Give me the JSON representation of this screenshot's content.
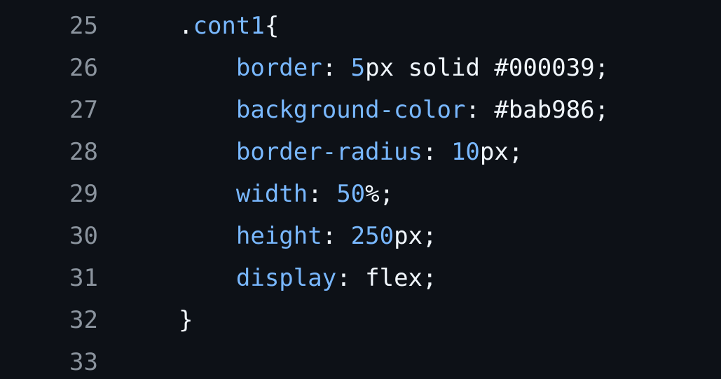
{
  "theme": {
    "background": "#0d1117",
    "line_number_color": "#8b949e",
    "keyword_color": "#79b8ff",
    "text_color": "#f0f6fc"
  },
  "lines": [
    {
      "number": "25",
      "tokens": [
        {
          "text": ".",
          "kind": "plain"
        },
        {
          "text": "cont1",
          "kind": "cls"
        },
        {
          "text": "{",
          "kind": "plain"
        }
      ]
    },
    {
      "number": "26",
      "tokens": [
        {
          "text": "    ",
          "kind": "plain"
        },
        {
          "text": "border",
          "kind": "prop"
        },
        {
          "text": ": ",
          "kind": "plain"
        },
        {
          "text": "5",
          "kind": "num"
        },
        {
          "text": "px solid #000039;",
          "kind": "plain"
        }
      ]
    },
    {
      "number": "27",
      "tokens": [
        {
          "text": "    ",
          "kind": "plain"
        },
        {
          "text": "background-color",
          "kind": "prop"
        },
        {
          "text": ": #bab986;",
          "kind": "plain"
        }
      ]
    },
    {
      "number": "28",
      "tokens": [
        {
          "text": "    ",
          "kind": "plain"
        },
        {
          "text": "border-radius",
          "kind": "prop"
        },
        {
          "text": ": ",
          "kind": "plain"
        },
        {
          "text": "10",
          "kind": "num"
        },
        {
          "text": "px;",
          "kind": "plain"
        }
      ]
    },
    {
      "number": "29",
      "tokens": [
        {
          "text": "    ",
          "kind": "plain"
        },
        {
          "text": "width",
          "kind": "prop"
        },
        {
          "text": ": ",
          "kind": "plain"
        },
        {
          "text": "50",
          "kind": "num"
        },
        {
          "text": "%;",
          "kind": "plain"
        }
      ]
    },
    {
      "number": "30",
      "tokens": [
        {
          "text": "    ",
          "kind": "plain"
        },
        {
          "text": "height",
          "kind": "prop"
        },
        {
          "text": ": ",
          "kind": "plain"
        },
        {
          "text": "250",
          "kind": "num"
        },
        {
          "text": "px;",
          "kind": "plain"
        }
      ]
    },
    {
      "number": "31",
      "tokens": [
        {
          "text": "    ",
          "kind": "plain"
        },
        {
          "text": "display",
          "kind": "prop"
        },
        {
          "text": ": flex;",
          "kind": "plain"
        }
      ]
    },
    {
      "number": "32",
      "tokens": [
        {
          "text": "}",
          "kind": "plain"
        }
      ]
    },
    {
      "number": "33",
      "tokens": []
    }
  ]
}
